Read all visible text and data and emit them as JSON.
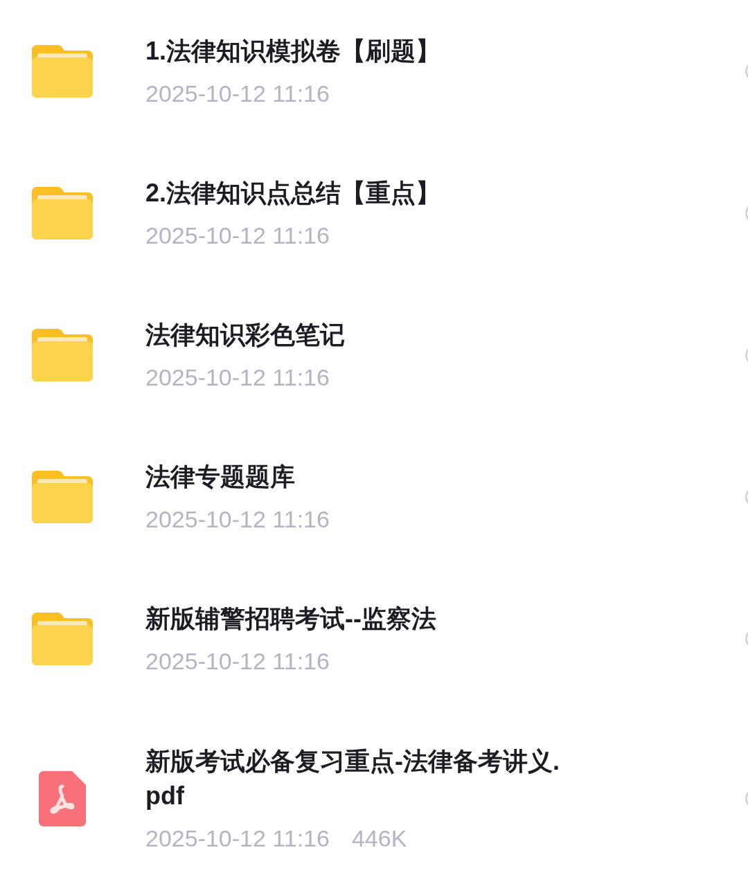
{
  "files": [
    {
      "kind": "folder",
      "name": "1.法律知识模拟卷【刷题】",
      "modified": "2025-10-12 11:16"
    },
    {
      "kind": "folder",
      "name": "2.法律知识点总结【重点】",
      "modified": "2025-10-12 11:16"
    },
    {
      "kind": "folder",
      "name": "法律知识彩色笔记",
      "modified": "2025-10-12 11:16"
    },
    {
      "kind": "folder",
      "name": "法律专题题库",
      "modified": "2025-10-12 11:16"
    },
    {
      "kind": "folder",
      "name": "新版辅警招聘考试--监察法",
      "modified": "2025-10-12 11:16"
    },
    {
      "kind": "pdf",
      "name": "新版考试必备复习重点-法律备考讲义.pdf",
      "modified": "2025-10-12 11:16",
      "size": "446K"
    }
  ]
}
